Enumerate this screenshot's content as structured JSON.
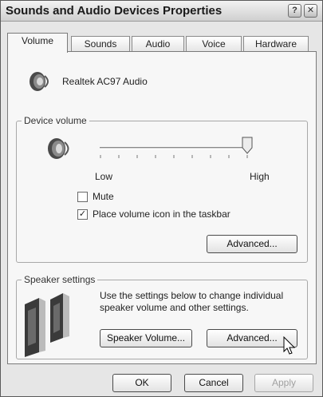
{
  "window": {
    "title": "Sounds and Audio Devices Properties",
    "help_glyph": "?",
    "close_glyph": "✕"
  },
  "tabs": [
    {
      "label": "Volume",
      "active": true
    },
    {
      "label": "Sounds",
      "active": false
    },
    {
      "label": "Audio",
      "active": false
    },
    {
      "label": "Voice",
      "active": false
    },
    {
      "label": "Hardware",
      "active": false
    }
  ],
  "device": {
    "name": "Realtek AC97 Audio",
    "icon": "speaker-icon"
  },
  "device_volume": {
    "group_label": "Device volume",
    "icon": "speaker-icon",
    "slider_min_label": "Low",
    "slider_max_label": "High",
    "level": 1.0,
    "mute_label": "Mute",
    "mute_checked": false,
    "taskbar_label": "Place volume icon in the taskbar",
    "taskbar_checked": true,
    "check_glyph": "✓",
    "advanced_label": "Advanced..."
  },
  "speaker_settings": {
    "group_label": "Speaker settings",
    "icon": "speakers-icon",
    "description": "Use the settings below to change individual speaker volume and other settings.",
    "speaker_volume_label": "Speaker Volume...",
    "advanced_label": "Advanced..."
  },
  "footer": {
    "ok_label": "OK",
    "cancel_label": "Cancel",
    "apply_label": "Apply"
  }
}
